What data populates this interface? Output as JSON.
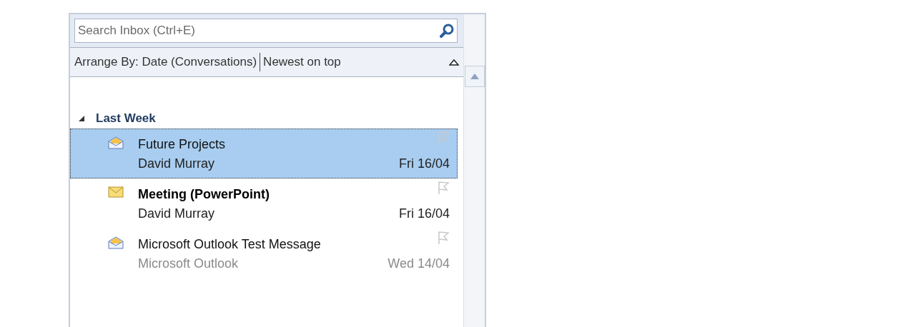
{
  "search": {
    "placeholder": "Search Inbox (Ctrl+E)"
  },
  "arrange": {
    "label": "Arrange By: Date (Conversations)",
    "order": "Newest on top"
  },
  "group": {
    "label": "Last Week",
    "expanded": true
  },
  "messages": [
    {
      "subject": "Future Projects",
      "sender": "David Murray",
      "date": "Fri 16/04",
      "unread": false,
      "greyed": false,
      "selected": true
    },
    {
      "subject": "Meeting (PowerPoint)",
      "sender": "David Murray",
      "date": "Fri 16/04",
      "unread": true,
      "greyed": false,
      "selected": false
    },
    {
      "subject": "Microsoft Outlook Test Message",
      "sender": "Microsoft Outlook",
      "date": "Wed 14/04",
      "unread": false,
      "greyed": true,
      "selected": false
    }
  ]
}
